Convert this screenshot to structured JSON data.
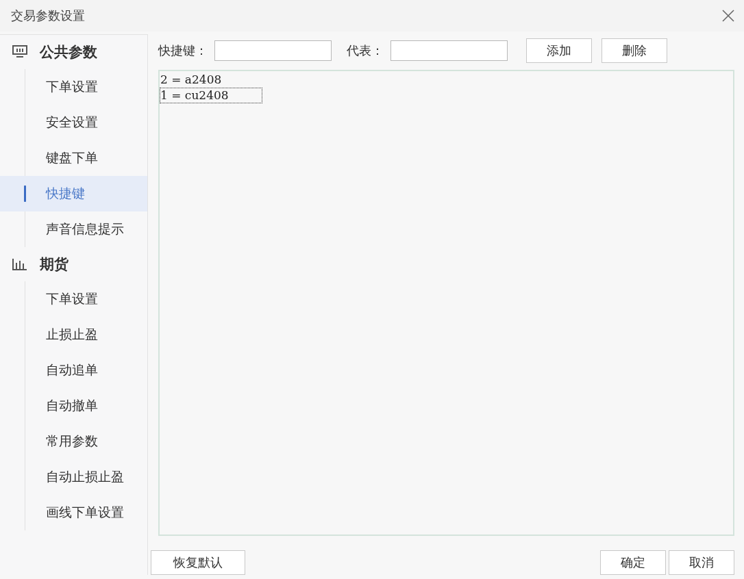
{
  "window": {
    "title": "交易参数设置"
  },
  "sidebar": {
    "groups": [
      {
        "label": "公共参数",
        "kind": "monitor",
        "items": [
          {
            "label": "下单设置",
            "selected": false
          },
          {
            "label": "安全设置",
            "selected": false
          },
          {
            "label": "键盘下单",
            "selected": false
          },
          {
            "label": "快捷键",
            "selected": true
          },
          {
            "label": "声音信息提示",
            "selected": false
          }
        ]
      },
      {
        "label": "期货",
        "kind": "chart",
        "items": [
          {
            "label": "下单设置",
            "selected": false
          },
          {
            "label": "止损止盈",
            "selected": false
          },
          {
            "label": "自动追单",
            "selected": false
          },
          {
            "label": "自动撤单",
            "selected": false
          },
          {
            "label": "常用参数",
            "selected": false
          },
          {
            "label": "自动止损止盈",
            "selected": false
          },
          {
            "label": "画线下单设置",
            "selected": false
          }
        ]
      }
    ]
  },
  "form": {
    "hotkey_label": "快捷键：",
    "represents_label": "代表：",
    "add_button": "添加",
    "delete_button": "删除"
  },
  "list": [
    {
      "text": "2 = a2408",
      "selected": false
    },
    {
      "text": "1 = cu2408",
      "selected": true
    }
  ],
  "footer": {
    "reset_button": "恢复默认",
    "ok_button": "确定",
    "cancel_button": "取消"
  }
}
